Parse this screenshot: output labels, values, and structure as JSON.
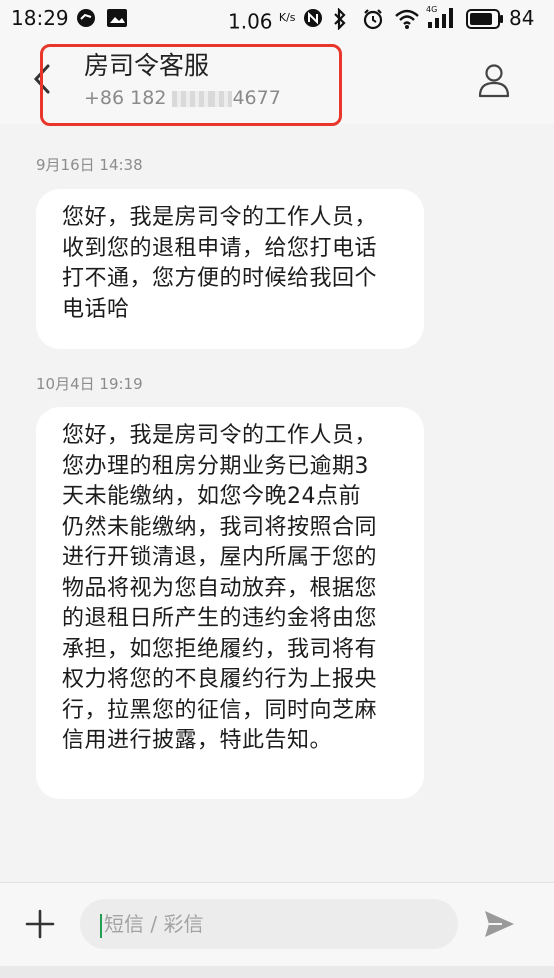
{
  "status_bar": {
    "time": "18:29",
    "network_speed": "1.06",
    "speed_unit": "K/s",
    "signal_label": "4G",
    "battery": "84"
  },
  "header": {
    "contact_name": "房司令客服",
    "number_prefix": "+86 182",
    "number_suffix": "4677",
    "highlight_color": "#e8372a"
  },
  "messages": [
    {
      "date": "9月16日 14:38",
      "lines": [
        "您好，我是房司令的工作人员，",
        "收到您的退租申请，给您打电话",
        "打不通，您方便的时候给我回个",
        "电话哈"
      ]
    },
    {
      "date": "10月4日 19:19",
      "lines": [
        "您好，我是房司令的工作人员，",
        "您办理的租房分期业务已逾期3",
        "天未能缴纳，如您今晚24点前",
        "仍然未能缴纳，我司将按照合同",
        "进行开锁清退，屋内所属于您的",
        "物品将视为您自动放弃，根据您",
        "的退租日所产生的违约金将由您",
        "承担，如您拒绝履约，我司将有",
        "权力将您的不良履约行为上报央",
        "行，拉黑您的征信，同时向芝麻",
        "信用进行披露，特此告知。"
      ]
    }
  ],
  "composer": {
    "placeholder": "短信 / 彩信",
    "caret_color": "#21a052"
  },
  "icons": {
    "back": "chevron-left-icon",
    "profile": "person-icon",
    "add": "plus-icon",
    "send": "send-icon"
  }
}
